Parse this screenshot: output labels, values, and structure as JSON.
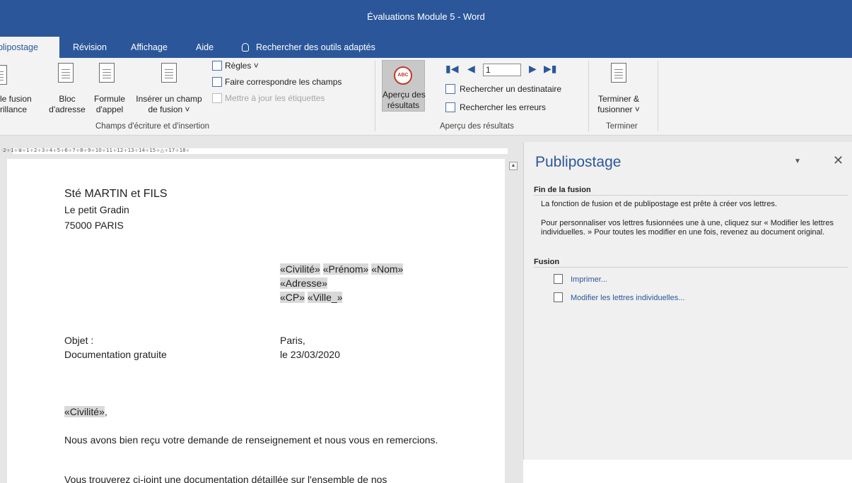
{
  "window": {
    "title": "Évaluations Module 5  -  Word"
  },
  "tabs": [
    "ublipostage",
    "Révision",
    "Affichage",
    "Aide"
  ],
  "tell_me": {
    "icon": "lightbulb-icon",
    "text": "Rechercher des outils adaptés"
  },
  "ribbon": {
    "fusion_line1": "le fusion",
    "fusion_line2": "rillance",
    "bloc_line1": "Bloc",
    "bloc_line2": "d'adresse",
    "formule_line1": "Formule",
    "formule_line2": "d'appel",
    "inserer_line1": "Insérer un champ",
    "inserer_line2": "de fusion ˅",
    "regles": "Règles ˅",
    "faire_correspondre": "Faire correspondre les champs",
    "mettre_a_jour": "Mettre à jour les étiquettes",
    "group1_label": "Champs d'écriture et d'insertion",
    "apercu_line1": "Aperçu des",
    "apercu_line2": "résultats",
    "record_number": "1",
    "rechercher_destinataire": "Rechercher un destinataire",
    "rechercher_erreurs": "Rechercher les erreurs",
    "group2_label": "Aperçu des résultats",
    "terminer_line1": "Terminer &",
    "terminer_line2": "fusionner ˅",
    "group3_label": "Terminer"
  },
  "ruler": {
    "text": "·2·ı·1·ı·ꓤ·ı·1·ı·2·ı·3·ı·4·ı·5·ı·6·ı·7·ı·8·ı·9·ı·10·ı·11·ı·12·ı·13·ı·14·ı·15·ı·△·ı·17·ı·18·ı"
  },
  "document": {
    "sender_name": "Sté MARTIN et FILS",
    "sender_addr1": "Le petit Gradin",
    "sender_addr2": "75000 PARIS",
    "f_civilite": "«Civilité»",
    "f_prenom": "«Prénom»",
    "f_nom": "«Nom»",
    "f_adresse": "«Adresse»",
    "f_cp": "«CP»",
    "f_ville": "«Ville_»",
    "objet_label": "Objet :",
    "objet_value": "Documentation gratuite",
    "place": "Paris,",
    "date": "le 23/03/2020",
    "salutation_field": "«Civilité»",
    "salutation_comma": ",",
    "para1": "Nous avons bien reçu votre demande de renseignement et nous vous en remercions.",
    "para2": "Vous trouverez ci-joint une documentation détaillée sur l'ensemble de nos"
  },
  "pane": {
    "title": "Publipostage",
    "close_icon": "close-icon",
    "section1": "Fin de la fusion",
    "text1": "La fonction de fusion et de publipostage est  prête à créer vos lettres.",
    "text2": "Pour personnaliser vos lettres fusionnées une à une, cliquez sur « Modifier les lettres individuelles. » Pour toutes les modifier en une fois, revenez au document original.",
    "section2": "Fusion",
    "link_print": "Imprimer...",
    "link_edit": "Modifier les lettres individuelles..."
  },
  "colors": {
    "brand": "#2b579a",
    "ribbon_bg": "#f3f3f3",
    "field_shade": "#d9d9d9"
  }
}
